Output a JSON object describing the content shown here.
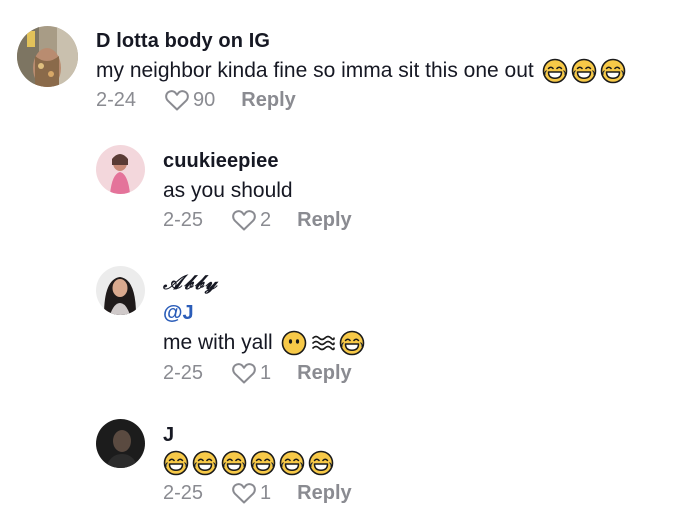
{
  "comments": [
    {
      "username": "D lotta body on IG",
      "text": "my neighbor kinda fine so imma sit this one out",
      "emojis": [
        "face-with-tears-of-joy-icon",
        "face-with-tears-of-joy-icon",
        "face-with-tears-of-joy-icon"
      ],
      "date": "2-24",
      "likes": "90",
      "reply_label": "Reply"
    },
    {
      "username": "cuukieepiee",
      "text": "as you should",
      "date": "2-25",
      "likes": "2",
      "reply_label": "Reply"
    },
    {
      "username": "𝒜𝒷𝒷𝓎",
      "mention": "@J",
      "text": "me with yall",
      "emojis": [
        "face-without-mouth-icon",
        "wind-face-icon",
        "face-with-tears-of-joy-icon"
      ],
      "date": "2-25",
      "likes": "1",
      "reply_label": "Reply"
    },
    {
      "username": "J",
      "emojis": [
        "face-with-tears-of-joy-icon",
        "face-with-tears-of-joy-icon",
        "face-with-tears-of-joy-icon",
        "face-with-tears-of-joy-icon",
        "face-with-tears-of-joy-icon",
        "face-with-tears-of-joy-icon"
      ],
      "date": "2-25",
      "likes": "1",
      "reply_label": "Reply"
    }
  ],
  "colors": {
    "text": "#161823",
    "secondary": "#8a8b91",
    "mention": "#2b5db9",
    "emoji_yellow": "#f7c948"
  }
}
